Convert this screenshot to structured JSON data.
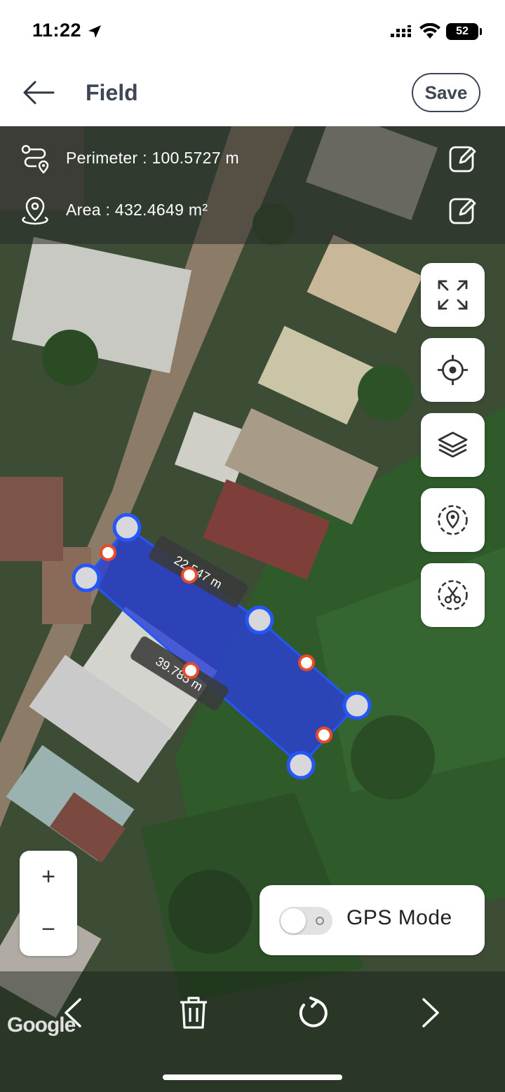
{
  "status_bar": {
    "time": "11:22",
    "battery": "52"
  },
  "header": {
    "title": "Field",
    "save_label": "Save"
  },
  "measurements": {
    "perimeter": "Perimeter : 100.5727 m",
    "area": "Area : 432.4649 m²"
  },
  "edge_labels": [
    "22.547 m",
    "39.785 m"
  ],
  "tools": [
    "fit-bounds-icon",
    "my-location-icon",
    "layers-icon",
    "location-ring-icon",
    "cut-icon"
  ],
  "zoom": {
    "in": "+",
    "out": "−"
  },
  "gps": {
    "label": "GPS Mode",
    "enabled": false
  },
  "map_attribution": "Google",
  "colors": {
    "polygon_fill": "#2b3fd6",
    "vertex_stroke": "#2457f5",
    "midpoint": "#e84a2a",
    "text_dark": "#3c4654"
  }
}
